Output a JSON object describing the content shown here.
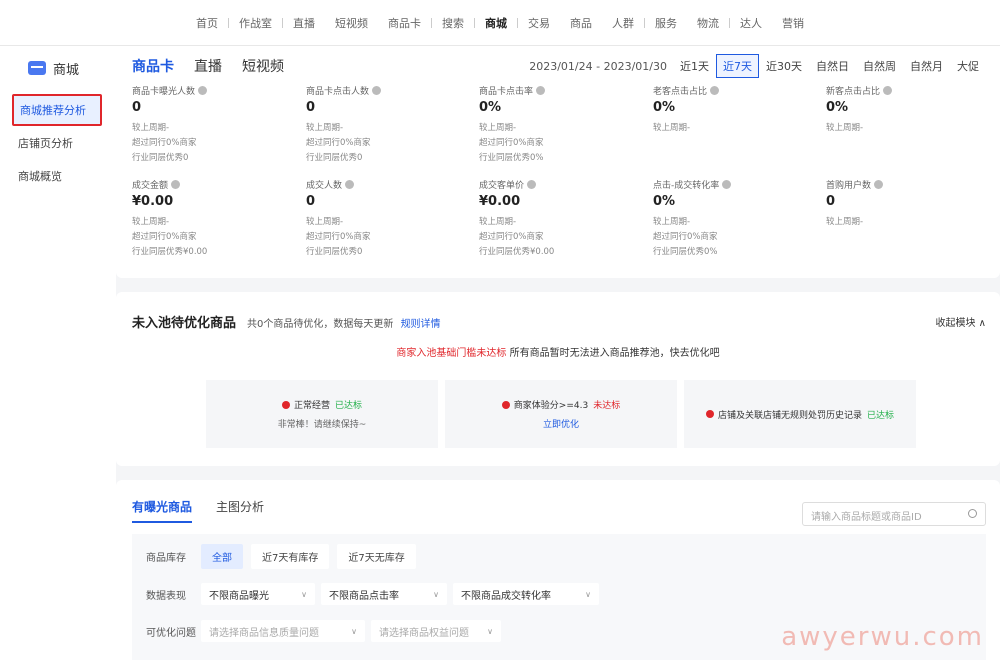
{
  "topnav": [
    "首页",
    "作战室",
    "直播",
    "短视频",
    "商品卡",
    "搜索",
    "商城",
    "交易",
    "商品",
    "人群",
    "服务",
    "物流",
    "达人",
    "营销"
  ],
  "topnav_active": "商城",
  "sidebar": {
    "brand": "商城",
    "items": [
      "商城推荐分析",
      "店铺页分析",
      "商城概览"
    ]
  },
  "header": {
    "tabs": [
      "商品卡",
      "直播",
      "短视频"
    ],
    "daterange": "2023/01/24 - 2023/01/30",
    "ranges": [
      "近1天",
      "近7天",
      "近30天",
      "自然日",
      "自然周",
      "自然月",
      "大促"
    ]
  },
  "metrics_row1": [
    {
      "label": "商品卡曝光人数",
      "value": "0",
      "sub": [
        "较上周期-",
        "超过同行0%商家",
        "行业同层优秀0"
      ]
    },
    {
      "label": "商品卡点击人数",
      "value": "0",
      "sub": [
        "较上周期-",
        "超过同行0%商家",
        "行业同层优秀0"
      ]
    },
    {
      "label": "商品卡点击率",
      "value": "0%",
      "sub": [
        "较上周期-",
        "超过同行0%商家",
        "行业同层优秀0%"
      ]
    },
    {
      "label": "老客点击占比",
      "value": "0%",
      "sub": [
        "较上周期-"
      ]
    },
    {
      "label": "新客点击占比",
      "value": "0%",
      "sub": [
        "较上周期-"
      ]
    }
  ],
  "metrics_row2": [
    {
      "label": "成交金额",
      "value": "¥0.00",
      "sub": [
        "较上周期-",
        "超过同行0%商家",
        "行业同层优秀¥0.00"
      ]
    },
    {
      "label": "成交人数",
      "value": "0",
      "sub": [
        "较上周期-",
        "超过同行0%商家",
        "行业同层优秀0"
      ]
    },
    {
      "label": "成交客单价",
      "value": "¥0.00",
      "sub": [
        "较上周期-",
        "超过同行0%商家",
        "行业同层优秀¥0.00"
      ]
    },
    {
      "label": "点击-成交转化率",
      "value": "0%",
      "sub": [
        "较上周期-",
        "超过同行0%商家",
        "行业同层优秀0%"
      ]
    },
    {
      "label": "首购用户数",
      "value": "0",
      "sub": [
        "较上周期-"
      ]
    }
  ],
  "pool": {
    "title": "未入池待优化商品",
    "desc": "共0个商品待优化，数据每天更新",
    "link": "规则详情",
    "collapse": "收起模块 ∧",
    "warn_red": "商家入池基础门槛未达标",
    "warn_rest": " 所有商品暂时无法进入商品推荐池，快去优化吧",
    "cards": [
      {
        "label": "正常经营",
        "status": "已达标",
        "status_type": "ok",
        "hint": "非常棒！请继续保持~"
      },
      {
        "label": "商家体验分>=4.3",
        "status": "未达标",
        "status_type": "bad",
        "hint": "立即优化"
      },
      {
        "label": "店铺及关联店铺无规则处罚历史记录",
        "status": "已达标",
        "status_type": "ok",
        "hint": ""
      }
    ]
  },
  "goods": {
    "tabs": [
      "有曝光商品",
      "主图分析"
    ],
    "search_placeholder": "请输入商品标题或商品ID",
    "stock_label": "商品库存",
    "stock_chips": [
      "全部",
      "近7天有库存",
      "近7天无库存"
    ],
    "perf_label": "数据表现",
    "perf_selects": [
      "不限商品曝光",
      "不限商品点击率",
      "不限商品成交转化率"
    ],
    "issue_label": "可优化问题",
    "issue_selects": [
      "请选择商品信息质量问题",
      "请选择商品权益问题"
    ]
  },
  "watermark": "awyerwu.com"
}
